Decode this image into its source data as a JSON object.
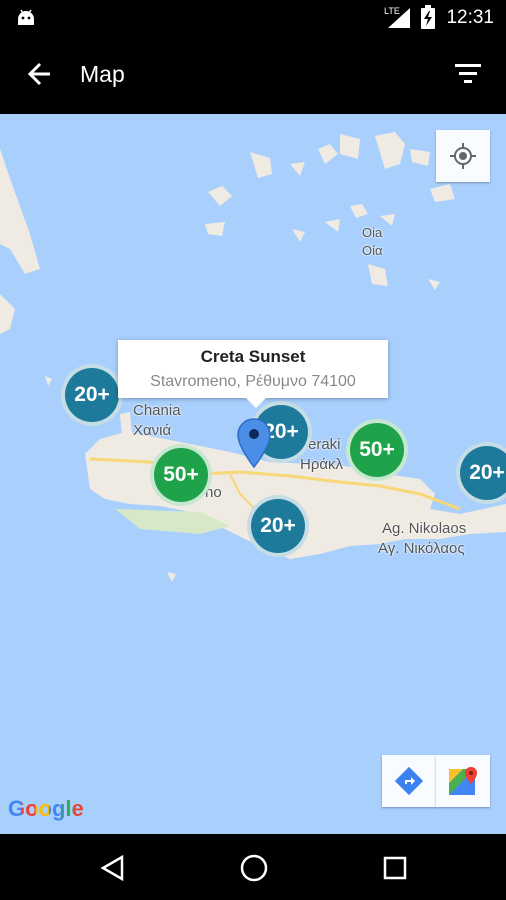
{
  "status_bar": {
    "time": "12:31",
    "network": "LTE"
  },
  "app_bar": {
    "title": "Map",
    "back_icon": "arrow-left-icon",
    "filter_icon": "filter-icon"
  },
  "map": {
    "info_window": {
      "title": "Creta Sunset",
      "subtitle": "Stavromeno, Ρέθυμνο 74100"
    },
    "clusters": [
      {
        "label": "20+",
        "color": "#1e7a9a"
      },
      {
        "label": "20+",
        "color": "#1e7a9a"
      },
      {
        "label": "20+",
        "color": "#1e7a9a"
      },
      {
        "label": "20+",
        "color": "#1e7a9a"
      },
      {
        "label": "50+",
        "color": "#1fa34a"
      },
      {
        "label": "50+",
        "color": "#1fa34a"
      }
    ],
    "labels": {
      "chania": "Chania",
      "chania_gr": "Χανιά",
      "oia": "Oia",
      "oia_gr": "Οία",
      "heraklion_partial": "eraki",
      "heraklion_gr_partial": "Ηράκλ",
      "rethymno_partial": "no",
      "agnikolaos": "Ag. Nikolaos",
      "agnikolaos_gr": "Αγ. Νικόλαος"
    },
    "attribution": "Google"
  },
  "colors": {
    "water": "#a9cffd",
    "land": "#efebe2",
    "cluster_teal": "#1e7a9a",
    "cluster_green": "#1fa34a",
    "marker": "#4a8ee8"
  }
}
